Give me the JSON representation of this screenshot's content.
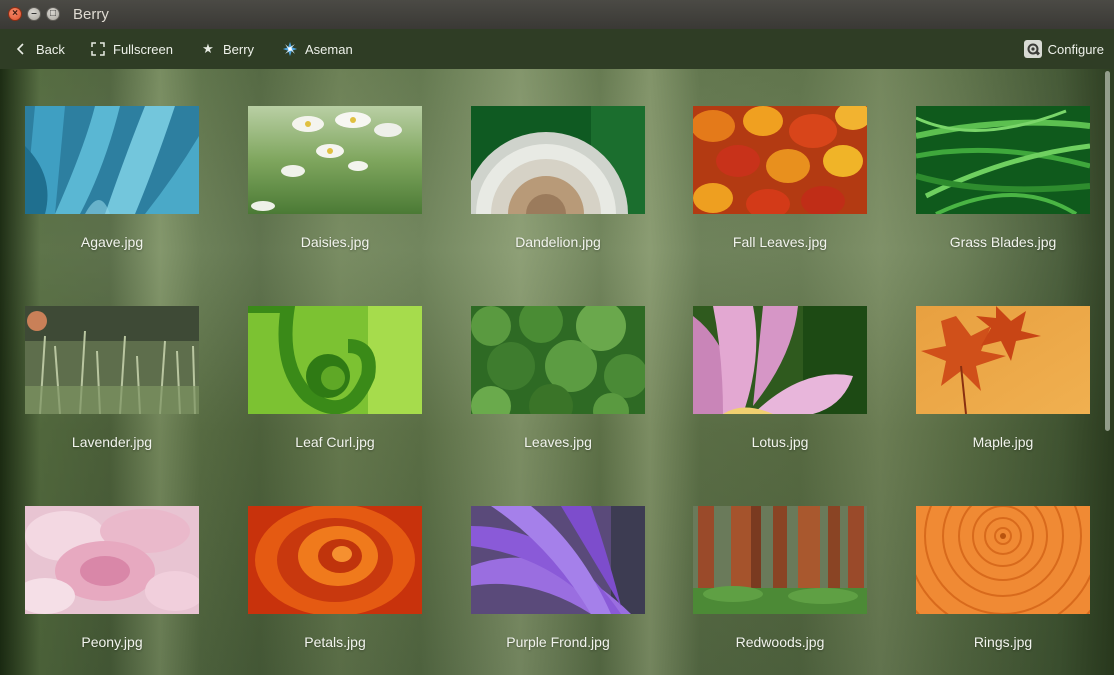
{
  "window": {
    "title": "Berry"
  },
  "toolbar": {
    "back_label": "Back",
    "fullscreen_label": "Fullscreen",
    "berry_label": "Berry",
    "aseman_label": "Aseman",
    "configure_label": "Configure"
  },
  "icons": {
    "back": "chevron-left-icon",
    "fullscreen": "fullscreen-icon",
    "berry": "star-icon",
    "aseman": "aseman-logo-icon",
    "configure": "configure-icon"
  },
  "images": [
    {
      "name": "Agave.jpg"
    },
    {
      "name": "Daisies.jpg"
    },
    {
      "name": "Dandelion.jpg"
    },
    {
      "name": "Fall Leaves.jpg"
    },
    {
      "name": "Grass Blades.jpg"
    },
    {
      "name": "Lavender.jpg"
    },
    {
      "name": "Leaf Curl.jpg"
    },
    {
      "name": "Leaves.jpg"
    },
    {
      "name": "Lotus.jpg"
    },
    {
      "name": "Maple.jpg"
    },
    {
      "name": "Peony.jpg"
    },
    {
      "name": "Petals.jpg"
    },
    {
      "name": "Purple Frond.jpg"
    },
    {
      "name": "Redwoods.jpg"
    },
    {
      "name": "Rings.jpg"
    }
  ]
}
